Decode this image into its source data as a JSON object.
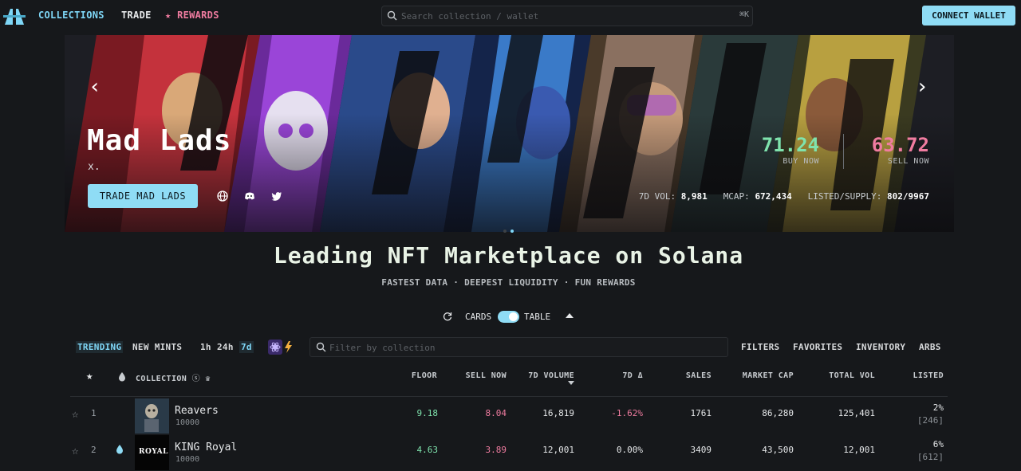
{
  "nav": {
    "logo_icon": "magic-eden-logo-icon",
    "collections": "COLLECTIONS",
    "trade": "TRADE",
    "rewards": "REWARDS",
    "search_placeholder": "Search collection / wallet",
    "search_shortcut": "⌘K",
    "connect": "CONNECT WALLET"
  },
  "hero": {
    "title": "Mad Lads",
    "subtitle": "x.",
    "trade_button": "TRADE MAD LADS",
    "buy_price": "71.24",
    "buy_label": "BUY NOW",
    "sell_price": "63.72",
    "sell_label": "SELL NOW",
    "vol_label": "7D VOL:",
    "vol_value": "8,981",
    "mcap_label": "MCAP:",
    "mcap_value": "672,434",
    "listed_label": "LISTED/SUPPLY:",
    "listed_value": "802/9967",
    "carousel_active_index": 1,
    "carousel_count": 2
  },
  "headline": "Leading NFT Marketplace on Solana",
  "tagline": "FASTEST DATA · DEEPEST LIQUIDITY · FUN REWARDS",
  "view": {
    "cards": "CARDS",
    "table": "TABLE",
    "table_selected": true
  },
  "filters": {
    "trending": "TRENDING",
    "new_mints": "NEW MINTS",
    "t1h": "1h",
    "t24h": "24h",
    "t7d": "7d",
    "search_placeholder": "Filter by collection",
    "filters": "FILTERS",
    "favorites": "FAVORITES",
    "inventory": "INVENTORY",
    "arbs": "ARBS"
  },
  "table": {
    "headers": {
      "collection": "COLLECTION",
      "floor": "FLOOR",
      "sell_now": "SELL NOW",
      "volume": "7D VOLUME",
      "change": "7D Δ",
      "sales": "SALES",
      "market_cap": "MARKET CAP",
      "total_vol": "TOTAL VOL",
      "listed": "LISTED"
    },
    "rows": [
      {
        "rank": "1",
        "name": "Reavers",
        "supply": "10000",
        "floor": "9.18",
        "sell_now": "8.04",
        "volume": "16,819",
        "change": "-1.62%",
        "sales": "1761",
        "market_cap": "86,280",
        "total_vol": "125,401",
        "listed_pct": "2%",
        "listed_count": "[246]"
      },
      {
        "rank": "2",
        "name": "KING Royal",
        "thumb_text": "ROYAL",
        "supply": "10000",
        "floor": "4.63",
        "sell_now": "3.89",
        "volume": "12,001",
        "change": "0.00%",
        "sales": "3409",
        "market_cap": "43,500",
        "total_vol": "12,001",
        "listed_pct": "6%",
        "listed_count": "[612]"
      }
    ]
  },
  "colors": {
    "accent": "#8fdcf5",
    "positive": "#7fe3ad",
    "negative": "#f07ca0",
    "background": "#16181b"
  }
}
